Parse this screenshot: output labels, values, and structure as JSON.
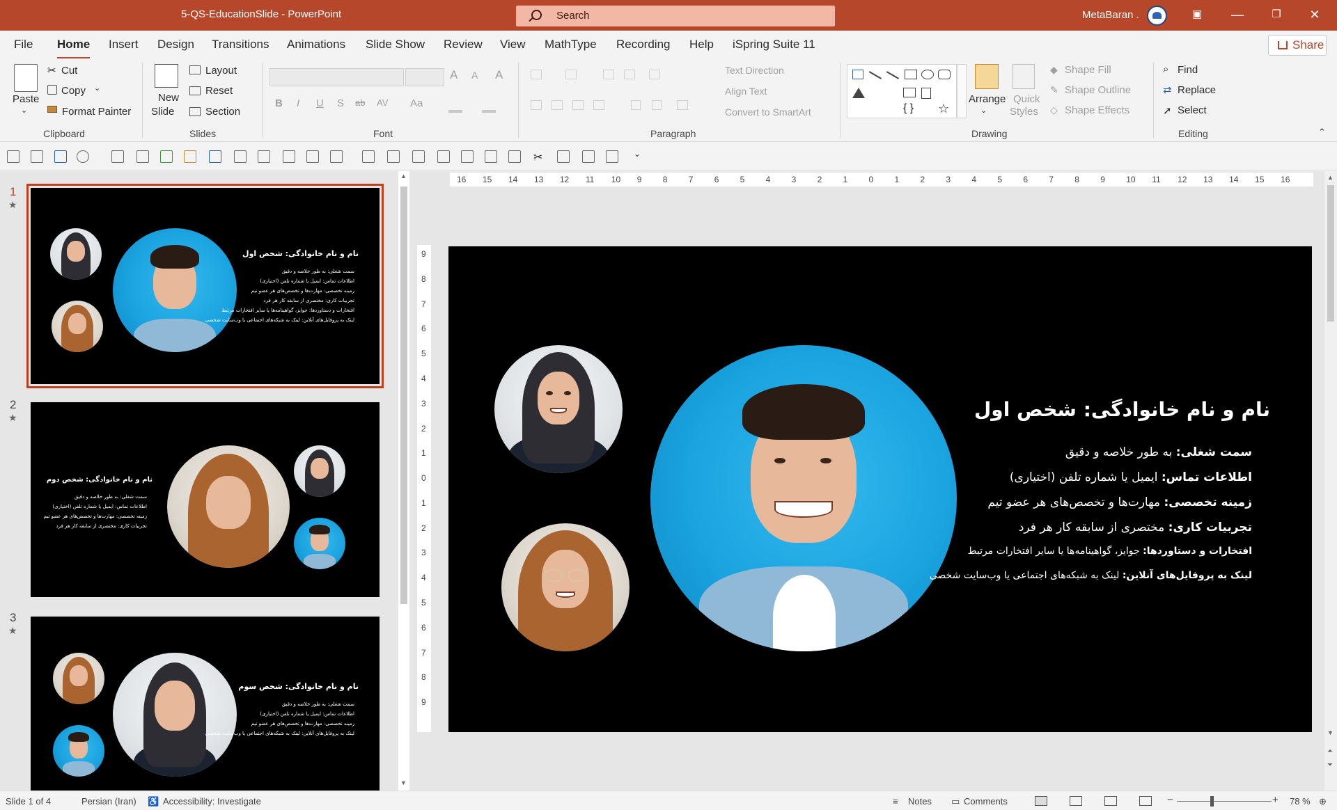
{
  "titlebar": {
    "document": "5-QS-EducationSlide  -  PowerPoint",
    "search_placeholder": "Search",
    "user": "MetaBaran .",
    "minimize": "—",
    "restore": "❐",
    "close": "✕",
    "ribbon_display": "▣"
  },
  "menu": {
    "file": "File",
    "home": "Home",
    "insert": "Insert",
    "design": "Design",
    "transitions": "Transitions",
    "animations": "Animations",
    "slideshow": "Slide Show",
    "review": "Review",
    "view": "View",
    "mathtype": "MathType",
    "recording": "Recording",
    "help": "Help",
    "ispring": "iSpring Suite 11",
    "share": "Share"
  },
  "ribbon": {
    "clipboard": {
      "paste": "Paste",
      "cut": "Cut",
      "copy": "Copy",
      "format_painter": "Format Painter",
      "label": "Clipboard"
    },
    "slides": {
      "new_slide": "New",
      "new_slide2": "Slide",
      "layout": "Layout",
      "reset": "Reset",
      "section": "Section",
      "label": "Slides"
    },
    "font": {
      "bold": "B",
      "italic": "I",
      "underline": "U",
      "shadow": "S",
      "strike": "ab",
      "spacing": "AV",
      "case": "Aa",
      "grow": "A",
      "shrink": "A",
      "label": "Font"
    },
    "paragraph": {
      "text_direction": "Text Direction",
      "align_text": "Align Text",
      "convert": "Convert to SmartArt",
      "label": "Paragraph"
    },
    "drawing": {
      "arrange": "Arrange",
      "quick_styles": "Quick",
      "quick_styles2": "Styles",
      "shape_fill": "Shape Fill",
      "shape_outline": "Shape Outline",
      "shape_effects": "Shape Effects",
      "label": "Drawing"
    },
    "editing": {
      "find": "Find",
      "replace": "Replace",
      "select": "Select",
      "label": "Editing"
    }
  },
  "slides": [
    {
      "number": "1",
      "title": "نام و نام خانوادگی: شخص اول",
      "lines": [
        "سمت شغلی: به طور خلاصه و دقیق",
        "اطلاعات تماس: ایمیل یا شماره تلفن (اختیاری)",
        "زمینه تخصصی: مهارت‌ها و تخصص‌های هر عضو تیم",
        "تجربیات کاری: مختصری از سابقه کار هر فرد",
        "افتخارات و دستاوردها: جوایز، گواهینامه‌ها یا سایر افتخارات مرتبط",
        "لینک به پروفایل‌های آنلاین: لینک به شبکه‌های اجتماعی یا وب‌سایت شخصی"
      ]
    },
    {
      "number": "2",
      "title": "نام و نام خانوادگی: شخص دوم",
      "lines": [
        "سمت شغلی: به طور خلاصه و دقیق",
        "اطلاعات تماس: ایمیل یا شماره تلفن (اختیاری)",
        "زمینه تخصصی: مهارت‌ها و تخصص‌های هر عضو تیم",
        "تجربیات کاری: مختصری از سابقه کار هر فرد"
      ]
    },
    {
      "number": "3",
      "title": "نام و نام خانوادگی: شخص سوم",
      "lines": [
        "سمت شغلی: به طور خلاصه و دقیق",
        "اطلاعات تماس: ایمیل یا شماره تلفن (اختیاری)",
        "زمینه تخصصی: مهارت‌ها و تخصص‌های هر عضو تیم",
        "لینک به پروفایل‌های آنلاین: لینک به شبکه‌های اجتماعی یا وب‌سایت شخصی"
      ]
    }
  ],
  "main_slide": {
    "title": "نام و نام خانوادگی: شخص اول",
    "l1_bold": "سمت شغلی:",
    "l1_rest": " به طور خلاصه و دقیق",
    "l2_bold": "اطلاعات تماس:",
    "l2_rest": " ایمیل یا شماره تلفن (اختیاری)",
    "l3_bold": "زمینه تخصصی:",
    "l3_rest": " مهارت‌ها و تخصص‌های هر عضو تیم",
    "l4_bold": "تجربیات کاری:",
    "l4_rest": " مختصری از سابقه کار هر فرد",
    "l5_bold": "افتخارات و دستاوردها:",
    "l5_rest": " جوایز، گواهینامه‌ها یا سایر افتخارات مرتبط",
    "l6_bold": "لینک به پروفایل‌های آنلاین:",
    "l6_rest": " لینک به شبکه‌های اجتماعی یا وب‌سایت شخصی"
  },
  "ruler_h": [
    "16",
    "15",
    "14",
    "13",
    "12",
    "11",
    "10",
    "9",
    "8",
    "7",
    "6",
    "5",
    "4",
    "3",
    "2",
    "1",
    "0",
    "1",
    "2",
    "3",
    "4",
    "5",
    "6",
    "7",
    "8",
    "9",
    "10",
    "11",
    "12",
    "13",
    "14",
    "15",
    "16"
  ],
  "ruler_v": [
    "9",
    "8",
    "7",
    "6",
    "5",
    "4",
    "3",
    "2",
    "1",
    "0",
    "1",
    "2",
    "3",
    "4",
    "5",
    "6",
    "7",
    "8",
    "9"
  ],
  "status": {
    "slide": "Slide 1 of 4",
    "language": "Persian (Iran)",
    "accessibility": "Accessibility: Investigate",
    "notes": "Notes",
    "comments": "Comments",
    "zoom": "78 %",
    "zoom_minus": "−",
    "zoom_plus": "+"
  },
  "colors": {
    "accent": "#b7472a",
    "selection": "#c43e1c"
  }
}
